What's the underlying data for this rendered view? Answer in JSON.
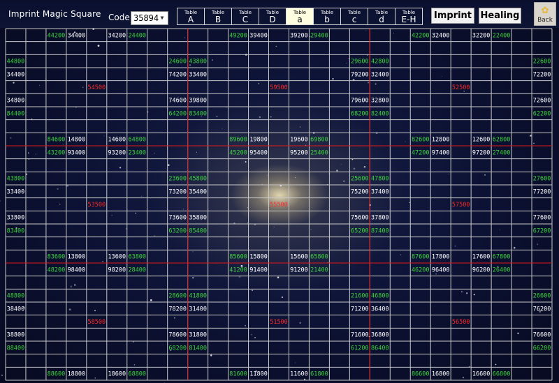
{
  "header": {
    "title": "Imprint Magic Square",
    "code_label": "Code:",
    "code_value": "35894",
    "tabs": [
      {
        "top": "Table",
        "label": "A"
      },
      {
        "top": "Table",
        "label": "B"
      },
      {
        "top": "Table",
        "label": "C"
      },
      {
        "top": "Table",
        "label": "D"
      },
      {
        "top": "Table",
        "label": "a",
        "active": true
      },
      {
        "top": "Table",
        "label": "b"
      },
      {
        "top": "Table",
        "label": "c"
      },
      {
        "top": "Table",
        "label": "d"
      },
      {
        "top": "Table",
        "label": "E-H"
      }
    ],
    "imprint_label": "Imprint",
    "healing_label": "Healing",
    "back_label": "Back"
  },
  "colors": {
    "green": "#3ad33a",
    "white": "#ffffff",
    "red": "#ff2a2a",
    "grid": "#c9c9c9",
    "divider": "#e01818",
    "active_tab": "#fffde0"
  },
  "grid": {
    "cols": 27,
    "rows": 27,
    "dividers": [
      9,
      18
    ],
    "cells": [
      {
        "r": 0,
        "c": 2,
        "t": "44200",
        "k": "g"
      },
      {
        "r": 0,
        "c": 3,
        "t": "34400",
        "k": "w"
      },
      {
        "r": 0,
        "c": 5,
        "t": "34200",
        "k": "w"
      },
      {
        "r": 0,
        "c": 6,
        "t": "24400",
        "k": "g"
      },
      {
        "r": 0,
        "c": 11,
        "t": "49200",
        "k": "g"
      },
      {
        "r": 0,
        "c": 12,
        "t": "39400",
        "k": "w"
      },
      {
        "r": 0,
        "c": 14,
        "t": "39200",
        "k": "w"
      },
      {
        "r": 0,
        "c": 15,
        "t": "29400",
        "k": "g"
      },
      {
        "r": 0,
        "c": 20,
        "t": "42200",
        "k": "g"
      },
      {
        "r": 0,
        "c": 21,
        "t": "32400",
        "k": "w"
      },
      {
        "r": 0,
        "c": 23,
        "t": "32200",
        "k": "w"
      },
      {
        "r": 0,
        "c": 24,
        "t": "22400",
        "k": "g"
      },
      {
        "r": 2,
        "c": 0,
        "t": "44800",
        "k": "g"
      },
      {
        "r": 2,
        "c": 8,
        "t": "24600",
        "k": "g"
      },
      {
        "r": 2,
        "c": 9,
        "t": "43800",
        "k": "g"
      },
      {
        "r": 2,
        "c": 17,
        "t": "29600",
        "k": "g"
      },
      {
        "r": 2,
        "c": 18,
        "t": "42800",
        "k": "g"
      },
      {
        "r": 2,
        "c": 26,
        "t": "22600",
        "k": "g"
      },
      {
        "r": 3,
        "c": 0,
        "t": "34400",
        "k": "w"
      },
      {
        "r": 3,
        "c": 8,
        "t": "74200",
        "k": "w"
      },
      {
        "r": 3,
        "c": 9,
        "t": "33400",
        "k": "w"
      },
      {
        "r": 3,
        "c": 17,
        "t": "79200",
        "k": "w"
      },
      {
        "r": 3,
        "c": 18,
        "t": "32400",
        "k": "w"
      },
      {
        "r": 3,
        "c": 26,
        "t": "72200",
        "k": "w"
      },
      {
        "r": 4,
        "c": 4,
        "t": "54500",
        "k": "r"
      },
      {
        "r": 4,
        "c": 13,
        "t": "59500",
        "k": "r"
      },
      {
        "r": 4,
        "c": 22,
        "t": "52500",
        "k": "r"
      },
      {
        "r": 5,
        "c": 0,
        "t": "34800",
        "k": "w"
      },
      {
        "r": 5,
        "c": 8,
        "t": "74600",
        "k": "w"
      },
      {
        "r": 5,
        "c": 9,
        "t": "39800",
        "k": "w"
      },
      {
        "r": 5,
        "c": 17,
        "t": "79600",
        "k": "w"
      },
      {
        "r": 5,
        "c": 18,
        "t": "32800",
        "k": "w"
      },
      {
        "r": 5,
        "c": 26,
        "t": "72600",
        "k": "w"
      },
      {
        "r": 6,
        "c": 0,
        "t": "84400",
        "k": "g"
      },
      {
        "r": 6,
        "c": 8,
        "t": "64200",
        "k": "g"
      },
      {
        "r": 6,
        "c": 9,
        "t": "83400",
        "k": "g"
      },
      {
        "r": 6,
        "c": 17,
        "t": "68200",
        "k": "g"
      },
      {
        "r": 6,
        "c": 18,
        "t": "82400",
        "k": "g"
      },
      {
        "r": 6,
        "c": 26,
        "t": "62200",
        "k": "g"
      },
      {
        "r": 8,
        "c": 2,
        "t": "84600",
        "k": "g"
      },
      {
        "r": 8,
        "c": 3,
        "t": "14800",
        "k": "w"
      },
      {
        "r": 8,
        "c": 5,
        "t": "14600",
        "k": "w"
      },
      {
        "r": 8,
        "c": 6,
        "t": "64800",
        "k": "g"
      },
      {
        "r": 8,
        "c": 11,
        "t": "89600",
        "k": "g"
      },
      {
        "r": 8,
        "c": 12,
        "t": "19800",
        "k": "w"
      },
      {
        "r": 8,
        "c": 14,
        "t": "19600",
        "k": "w"
      },
      {
        "r": 8,
        "c": 15,
        "t": "69800",
        "k": "g"
      },
      {
        "r": 8,
        "c": 20,
        "t": "82600",
        "k": "g"
      },
      {
        "r": 8,
        "c": 21,
        "t": "12800",
        "k": "w"
      },
      {
        "r": 8,
        "c": 23,
        "t": "12600",
        "k": "w"
      },
      {
        "r": 8,
        "c": 24,
        "t": "62800",
        "k": "g"
      },
      {
        "r": 9,
        "c": 2,
        "t": "43200",
        "k": "g"
      },
      {
        "r": 9,
        "c": 3,
        "t": "93400",
        "k": "w"
      },
      {
        "r": 9,
        "c": 5,
        "t": "93200",
        "k": "w"
      },
      {
        "r": 9,
        "c": 6,
        "t": "23400",
        "k": "g"
      },
      {
        "r": 9,
        "c": 11,
        "t": "45200",
        "k": "g"
      },
      {
        "r": 9,
        "c": 12,
        "t": "95400",
        "k": "w"
      },
      {
        "r": 9,
        "c": 14,
        "t": "95200",
        "k": "w"
      },
      {
        "r": 9,
        "c": 15,
        "t": "25400",
        "k": "g"
      },
      {
        "r": 9,
        "c": 20,
        "t": "47200",
        "k": "g"
      },
      {
        "r": 9,
        "c": 21,
        "t": "97400",
        "k": "w"
      },
      {
        "r": 9,
        "c": 23,
        "t": "97200",
        "k": "w"
      },
      {
        "r": 9,
        "c": 24,
        "t": "27400",
        "k": "g"
      },
      {
        "r": 11,
        "c": 0,
        "t": "43800",
        "k": "g"
      },
      {
        "r": 11,
        "c": 8,
        "t": "23600",
        "k": "g"
      },
      {
        "r": 11,
        "c": 9,
        "t": "45800",
        "k": "g"
      },
      {
        "r": 11,
        "c": 17,
        "t": "25600",
        "k": "g"
      },
      {
        "r": 11,
        "c": 18,
        "t": "47800",
        "k": "g"
      },
      {
        "r": 11,
        "c": 26,
        "t": "27600",
        "k": "g"
      },
      {
        "r": 12,
        "c": 0,
        "t": "33400",
        "k": "w"
      },
      {
        "r": 12,
        "c": 8,
        "t": "73200",
        "k": "w"
      },
      {
        "r": 12,
        "c": 9,
        "t": "35400",
        "k": "w"
      },
      {
        "r": 12,
        "c": 17,
        "t": "75200",
        "k": "w"
      },
      {
        "r": 12,
        "c": 18,
        "t": "37400",
        "k": "w"
      },
      {
        "r": 12,
        "c": 26,
        "t": "77200",
        "k": "w"
      },
      {
        "r": 13,
        "c": 4,
        "t": "53500",
        "k": "r"
      },
      {
        "r": 13,
        "c": 13,
        "t": "55500",
        "k": "r"
      },
      {
        "r": 13,
        "c": 22,
        "t": "57500",
        "k": "r"
      },
      {
        "r": 14,
        "c": 0,
        "t": "33800",
        "k": "w"
      },
      {
        "r": 14,
        "c": 8,
        "t": "73600",
        "k": "w"
      },
      {
        "r": 14,
        "c": 9,
        "t": "35800",
        "k": "w"
      },
      {
        "r": 14,
        "c": 17,
        "t": "75600",
        "k": "w"
      },
      {
        "r": 14,
        "c": 18,
        "t": "37800",
        "k": "w"
      },
      {
        "r": 14,
        "c": 26,
        "t": "77600",
        "k": "w"
      },
      {
        "r": 15,
        "c": 0,
        "t": "83400",
        "k": "g"
      },
      {
        "r": 15,
        "c": 8,
        "t": "63200",
        "k": "g"
      },
      {
        "r": 15,
        "c": 9,
        "t": "85400",
        "k": "g"
      },
      {
        "r": 15,
        "c": 17,
        "t": "65200",
        "k": "g"
      },
      {
        "r": 15,
        "c": 18,
        "t": "87400",
        "k": "g"
      },
      {
        "r": 15,
        "c": 26,
        "t": "67200",
        "k": "g"
      },
      {
        "r": 17,
        "c": 2,
        "t": "83600",
        "k": "g"
      },
      {
        "r": 17,
        "c": 3,
        "t": "13800",
        "k": "w"
      },
      {
        "r": 17,
        "c": 5,
        "t": "13600",
        "k": "w"
      },
      {
        "r": 17,
        "c": 6,
        "t": "63800",
        "k": "g"
      },
      {
        "r": 17,
        "c": 11,
        "t": "85600",
        "k": "g"
      },
      {
        "r": 17,
        "c": 12,
        "t": "15800",
        "k": "w"
      },
      {
        "r": 17,
        "c": 14,
        "t": "15600",
        "k": "w"
      },
      {
        "r": 17,
        "c": 15,
        "t": "65800",
        "k": "g"
      },
      {
        "r": 17,
        "c": 20,
        "t": "87600",
        "k": "g"
      },
      {
        "r": 17,
        "c": 21,
        "t": "17800",
        "k": "w"
      },
      {
        "r": 17,
        "c": 23,
        "t": "17600",
        "k": "w"
      },
      {
        "r": 17,
        "c": 24,
        "t": "67800",
        "k": "g"
      },
      {
        "r": 18,
        "c": 2,
        "t": "48200",
        "k": "g"
      },
      {
        "r": 18,
        "c": 3,
        "t": "98400",
        "k": "w"
      },
      {
        "r": 18,
        "c": 5,
        "t": "98200",
        "k": "w"
      },
      {
        "r": 18,
        "c": 6,
        "t": "28400",
        "k": "g"
      },
      {
        "r": 18,
        "c": 11,
        "t": "41200",
        "k": "g"
      },
      {
        "r": 18,
        "c": 12,
        "t": "91400",
        "k": "w"
      },
      {
        "r": 18,
        "c": 14,
        "t": "91200",
        "k": "w"
      },
      {
        "r": 18,
        "c": 15,
        "t": "21400",
        "k": "g"
      },
      {
        "r": 18,
        "c": 20,
        "t": "46200",
        "k": "g"
      },
      {
        "r": 18,
        "c": 21,
        "t": "96400",
        "k": "w"
      },
      {
        "r": 18,
        "c": 23,
        "t": "96200",
        "k": "w"
      },
      {
        "r": 18,
        "c": 24,
        "t": "26400",
        "k": "g"
      },
      {
        "r": 20,
        "c": 0,
        "t": "48800",
        "k": "g"
      },
      {
        "r": 20,
        "c": 8,
        "t": "28600",
        "k": "g"
      },
      {
        "r": 20,
        "c": 9,
        "t": "41800",
        "k": "g"
      },
      {
        "r": 20,
        "c": 17,
        "t": "21600",
        "k": "g"
      },
      {
        "r": 20,
        "c": 18,
        "t": "46800",
        "k": "g"
      },
      {
        "r": 20,
        "c": 26,
        "t": "26600",
        "k": "g"
      },
      {
        "r": 21,
        "c": 0,
        "t": "38400",
        "k": "w"
      },
      {
        "r": 21,
        "c": 8,
        "t": "78200",
        "k": "w"
      },
      {
        "r": 21,
        "c": 9,
        "t": "31400",
        "k": "w"
      },
      {
        "r": 21,
        "c": 17,
        "t": "71200",
        "k": "w"
      },
      {
        "r": 21,
        "c": 18,
        "t": "36400",
        "k": "w"
      },
      {
        "r": 21,
        "c": 26,
        "t": "76200",
        "k": "w"
      },
      {
        "r": 22,
        "c": 4,
        "t": "58500",
        "k": "r"
      },
      {
        "r": 22,
        "c": 13,
        "t": "51500",
        "k": "r"
      },
      {
        "r": 22,
        "c": 22,
        "t": "56500",
        "k": "r"
      },
      {
        "r": 23,
        "c": 0,
        "t": "38800",
        "k": "w"
      },
      {
        "r": 23,
        "c": 8,
        "t": "78600",
        "k": "w"
      },
      {
        "r": 23,
        "c": 9,
        "t": "31800",
        "k": "w"
      },
      {
        "r": 23,
        "c": 17,
        "t": "71600",
        "k": "w"
      },
      {
        "r": 23,
        "c": 18,
        "t": "36800",
        "k": "w"
      },
      {
        "r": 23,
        "c": 26,
        "t": "76600",
        "k": "w"
      },
      {
        "r": 24,
        "c": 0,
        "t": "88400",
        "k": "g"
      },
      {
        "r": 24,
        "c": 8,
        "t": "68200",
        "k": "g"
      },
      {
        "r": 24,
        "c": 9,
        "t": "81400",
        "k": "g"
      },
      {
        "r": 24,
        "c": 17,
        "t": "61200",
        "k": "g"
      },
      {
        "r": 24,
        "c": 18,
        "t": "86400",
        "k": "g"
      },
      {
        "r": 24,
        "c": 26,
        "t": "66200",
        "k": "g"
      },
      {
        "r": 26,
        "c": 2,
        "t": "88600",
        "k": "g"
      },
      {
        "r": 26,
        "c": 3,
        "t": "18800",
        "k": "w"
      },
      {
        "r": 26,
        "c": 5,
        "t": "18600",
        "k": "w"
      },
      {
        "r": 26,
        "c": 6,
        "t": "68800",
        "k": "g"
      },
      {
        "r": 26,
        "c": 11,
        "t": "81600",
        "k": "g"
      },
      {
        "r": 26,
        "c": 12,
        "t": "11800",
        "k": "w"
      },
      {
        "r": 26,
        "c": 14,
        "t": "11600",
        "k": "w"
      },
      {
        "r": 26,
        "c": 15,
        "t": "61800",
        "k": "g"
      },
      {
        "r": 26,
        "c": 20,
        "t": "86600",
        "k": "g"
      },
      {
        "r": 26,
        "c": 21,
        "t": "16800",
        "k": "w"
      },
      {
        "r": 26,
        "c": 23,
        "t": "16600",
        "k": "w"
      },
      {
        "r": 26,
        "c": 24,
        "t": "66800",
        "k": "g"
      }
    ]
  }
}
